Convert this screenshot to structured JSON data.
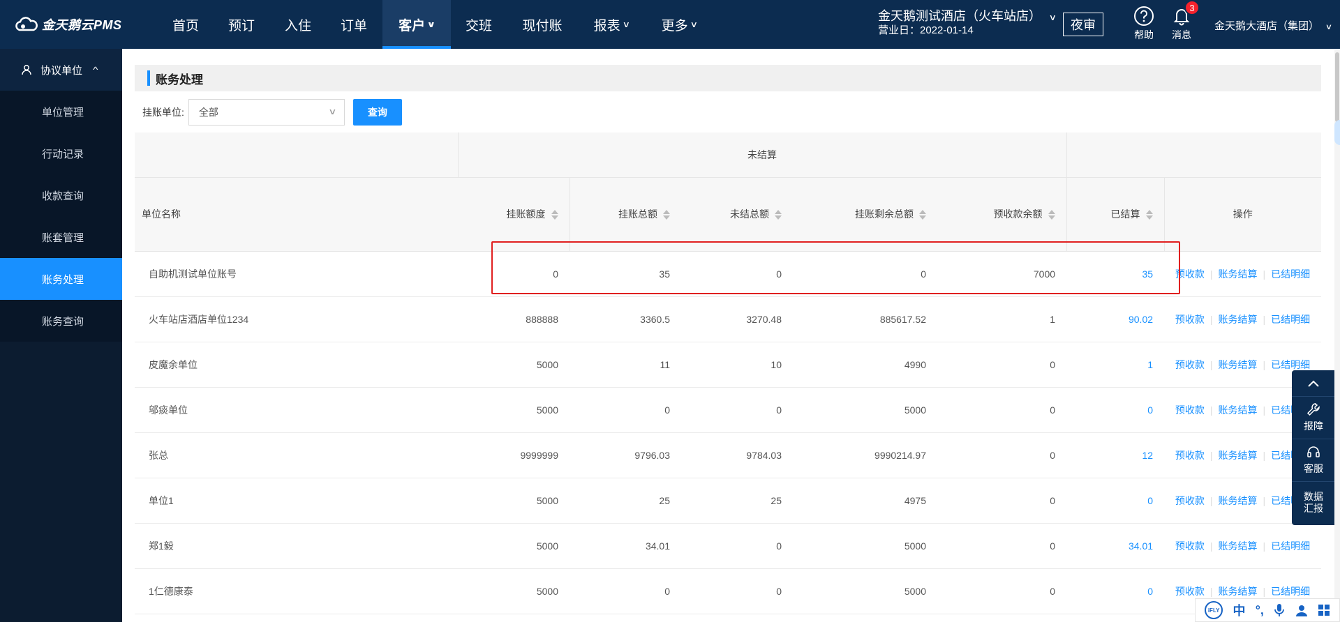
{
  "app": {
    "logo_text": "金天鹅云PMS"
  },
  "nav": {
    "items": [
      {
        "label": "首页",
        "dropdown": false
      },
      {
        "label": "预订",
        "dropdown": false
      },
      {
        "label": "入住",
        "dropdown": false
      },
      {
        "label": "订单",
        "dropdown": false
      },
      {
        "label": "客户",
        "dropdown": true,
        "active": true
      },
      {
        "label": "交班",
        "dropdown": false
      },
      {
        "label": "现付账",
        "dropdown": false
      },
      {
        "label": "报表",
        "dropdown": true
      },
      {
        "label": "更多",
        "dropdown": true
      }
    ],
    "chevron": "∨"
  },
  "header": {
    "hotel_name": "金天鹅测试酒店（火车站店）",
    "business_day": "营业日：2022-01-14",
    "audit_label": "夜审",
    "help_label": "帮助",
    "message_label": "消息",
    "message_count": "3",
    "group_name": "金天鹅大酒店（集团）"
  },
  "sidebar": {
    "section_label": "协议单位",
    "items": [
      {
        "label": "单位管理"
      },
      {
        "label": "行动记录"
      },
      {
        "label": "收款查询"
      },
      {
        "label": "账套管理"
      },
      {
        "label": "账务处理",
        "active": true
      },
      {
        "label": "账务查询"
      }
    ]
  },
  "page": {
    "title": "账务处理",
    "filter_label": "挂账单位:",
    "filter_value": "全部",
    "query_label": "查询"
  },
  "table": {
    "group_header": "未结算",
    "headers": {
      "name": "单位名称",
      "credit_limit": "挂账额度",
      "total_credit": "挂账总额",
      "unsettled_total": "未结总额",
      "remaining": "挂账剩余总额",
      "prepaid_balance": "预收款余额",
      "settled": "已结算",
      "actions": "操作"
    },
    "action_labels": [
      "预收款",
      "账务结算",
      "已结明细"
    ],
    "rows": [
      {
        "name": "自助机测试单位账号",
        "credit_limit": "0",
        "total_credit": "35",
        "unsettled_total": "0",
        "remaining": "0",
        "prepaid_balance": "7000",
        "settled": "35"
      },
      {
        "name": "火车站店酒店单位1234",
        "credit_limit": "888888",
        "total_credit": "3360.5",
        "unsettled_total": "3270.48",
        "remaining": "885617.52",
        "prepaid_balance": "1",
        "settled": "90.02"
      },
      {
        "name": "皮魔余单位",
        "credit_limit": "5000",
        "total_credit": "11",
        "unsettled_total": "10",
        "remaining": "4990",
        "prepaid_balance": "0",
        "settled": "1"
      },
      {
        "name": "邬痰单位",
        "credit_limit": "5000",
        "total_credit": "0",
        "unsettled_total": "0",
        "remaining": "5000",
        "prepaid_balance": "0",
        "settled": "0"
      },
      {
        "name": "张总",
        "credit_limit": "9999999",
        "total_credit": "9796.03",
        "unsettled_total": "9784.03",
        "remaining": "9990214.97",
        "prepaid_balance": "0",
        "settled": "12"
      },
      {
        "name": "单位1",
        "credit_limit": "5000",
        "total_credit": "25",
        "unsettled_total": "25",
        "remaining": "4975",
        "prepaid_balance": "0",
        "settled": "0"
      },
      {
        "name": "郑1毅",
        "credit_limit": "5000",
        "total_credit": "34.01",
        "unsettled_total": "0",
        "remaining": "5000",
        "prepaid_balance": "0",
        "settled": "34.01"
      },
      {
        "name": "1仁德康泰",
        "credit_limit": "5000",
        "total_credit": "0",
        "unsettled_total": "0",
        "remaining": "5000",
        "prepaid_balance": "0",
        "settled": "0"
      }
    ]
  },
  "float_panel": {
    "report_label": "报障",
    "service_label": "客服",
    "data_label_1": "数据",
    "data_label_2": "汇报"
  },
  "ime": {
    "logo": "iFLY",
    "zh": "中"
  },
  "colors": {
    "nav_bg": "#0c2c50",
    "accent": "#1890ff",
    "highlight": "#e02020"
  }
}
